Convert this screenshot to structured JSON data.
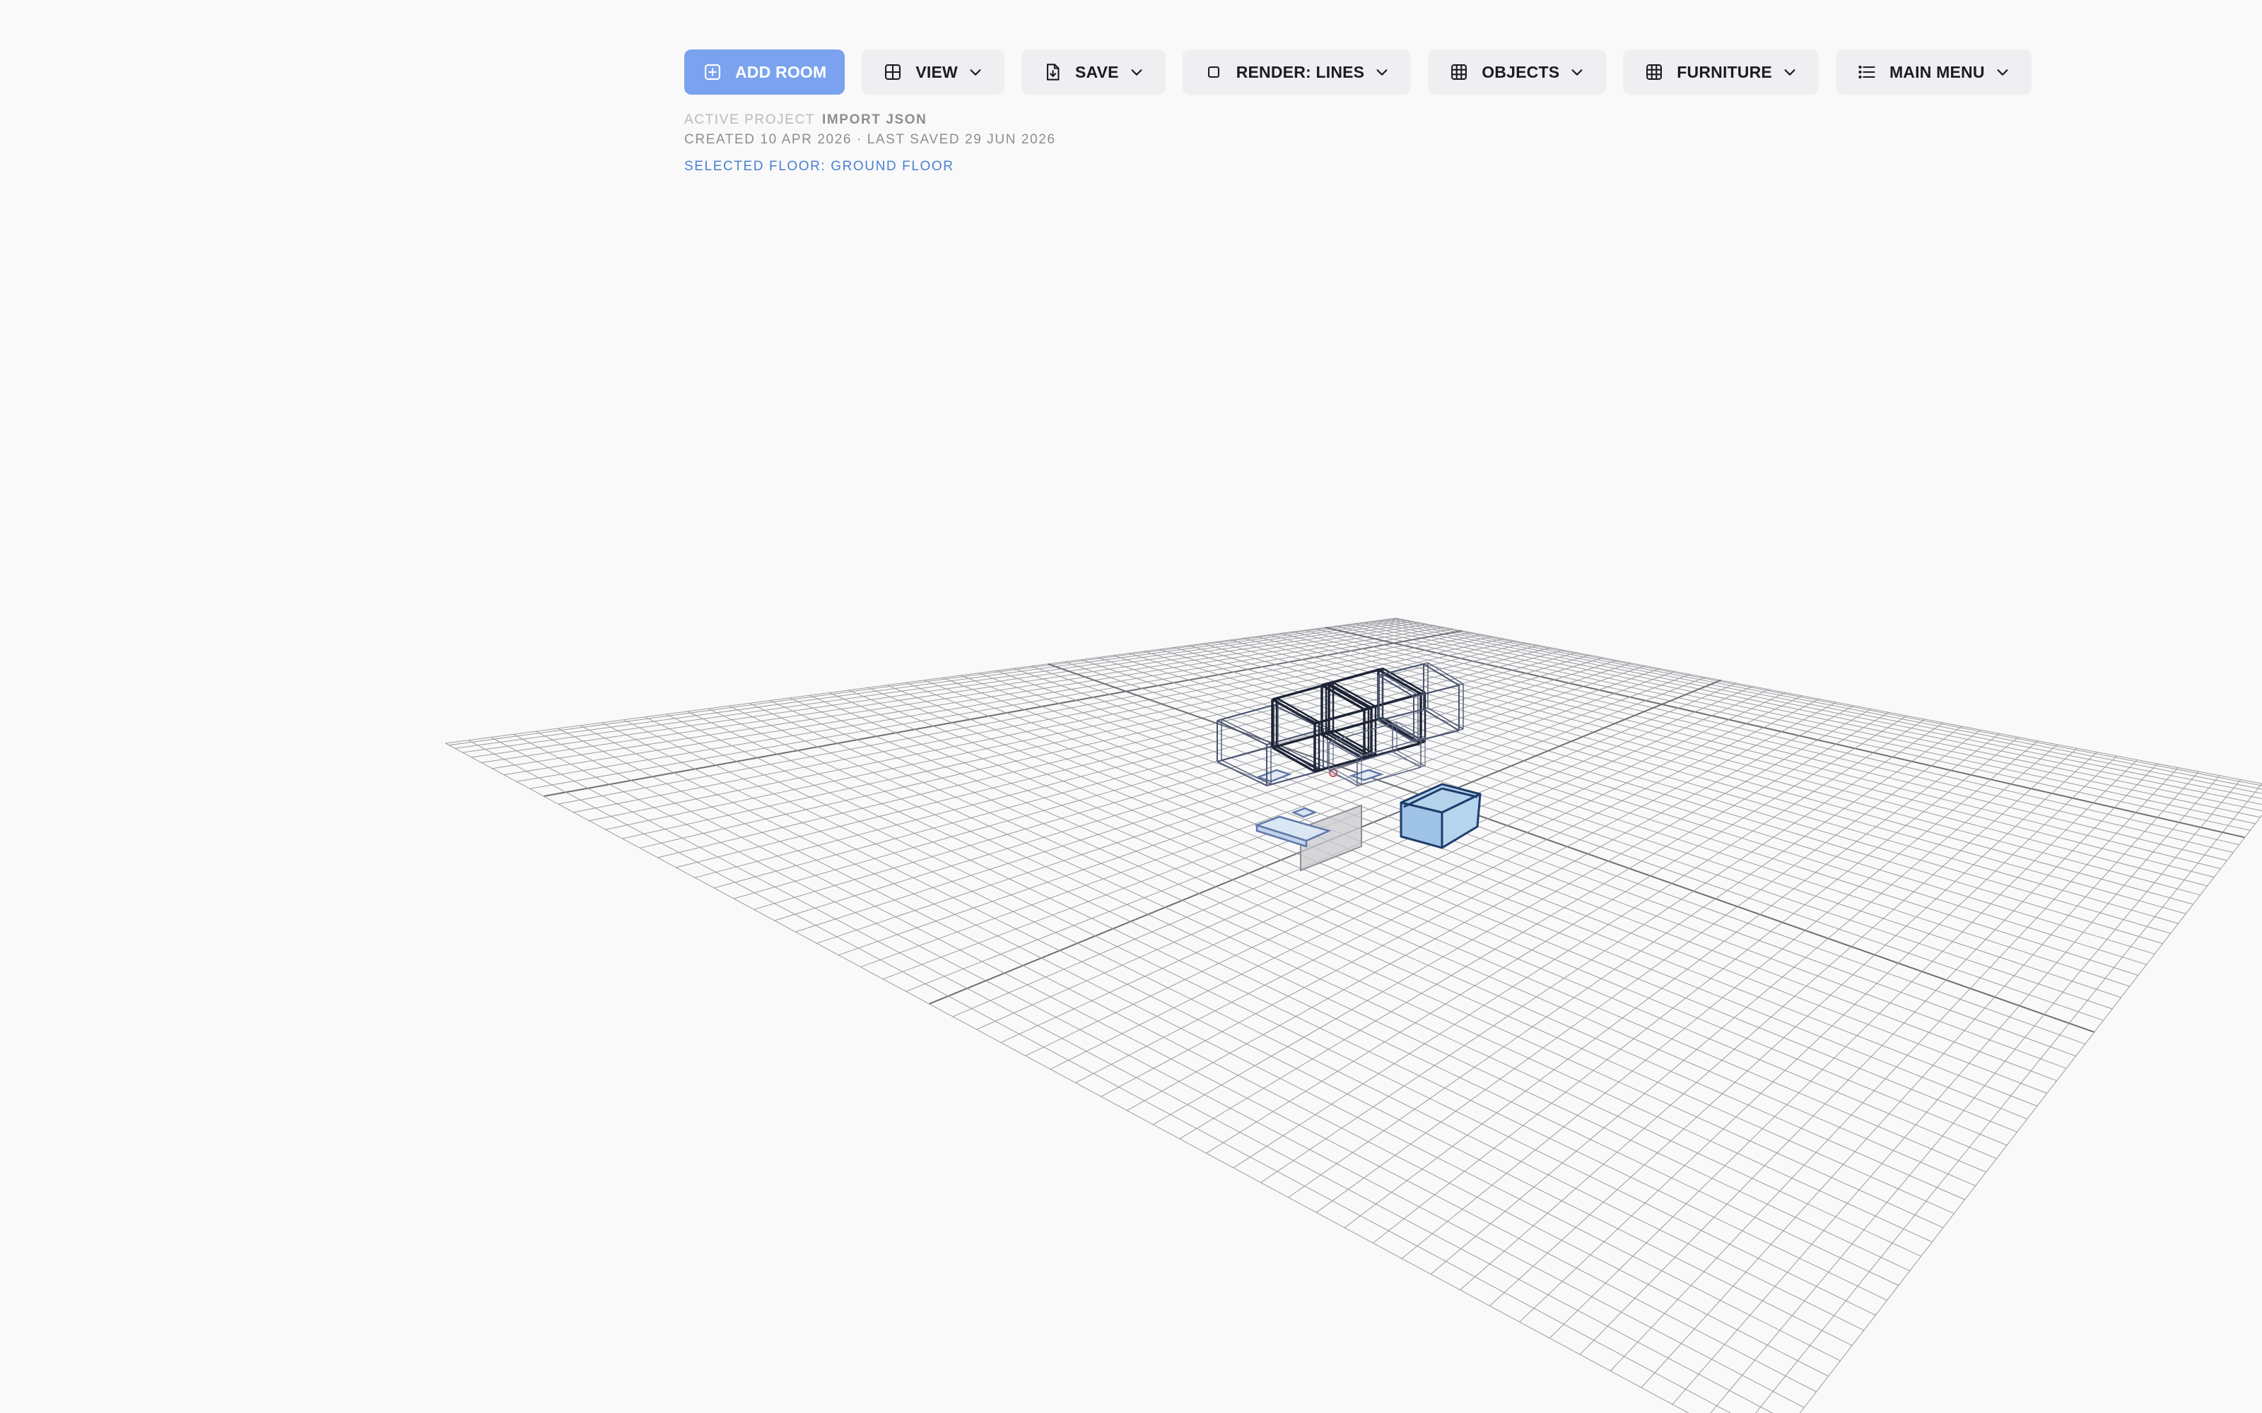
{
  "toolbar": {
    "add_room": "ADD ROOM",
    "view": "VIEW",
    "save": "SAVE",
    "render": "RENDER: LINES",
    "objects": "OBJECTS",
    "furniture": "FURNITURE",
    "main_menu": "MAIN MENU"
  },
  "project": {
    "label": "ACTIVE PROJECT",
    "name": "IMPORT JSON",
    "dates": "CREATED 10 APR 2026 · LAST SAVED 29 JUN 2026",
    "selected_floor": "SELECTED FLOOR: GROUND FLOOR"
  },
  "colors": {
    "accent": "#7ba2ef",
    "floor_link": "#4a7fd3",
    "grid": "#8f9096",
    "wireframe": "#1e2436",
    "selected_box": "#a9c8e6"
  },
  "icons": {
    "add_room": "plus-square-icon",
    "view": "grid-2x2-icon",
    "save": "file-download-icon",
    "render": "square-icon",
    "objects": "grid-3x3-icon",
    "furniture": "grid-3x3-icon",
    "main_menu": "list-icon",
    "dropdown": "chevron-down-icon"
  }
}
